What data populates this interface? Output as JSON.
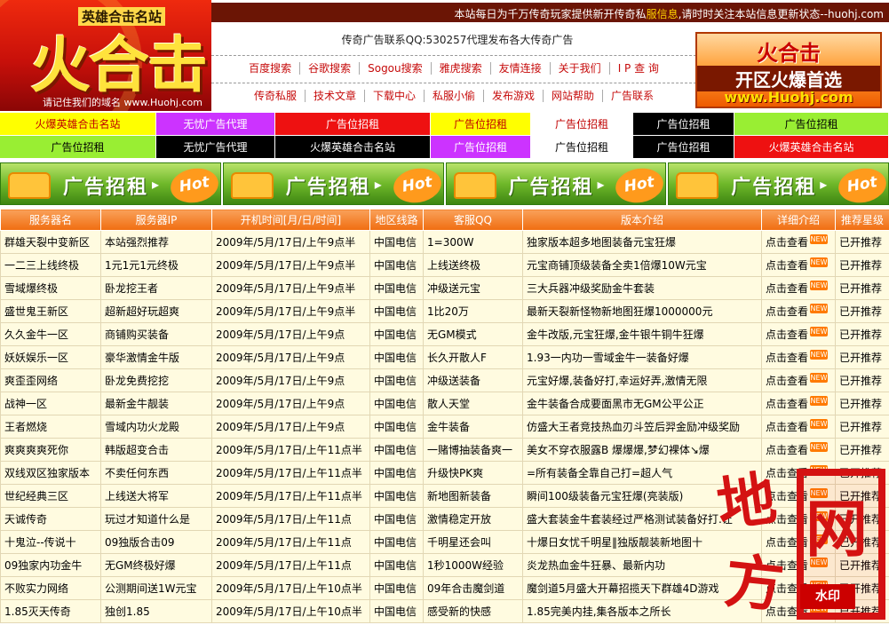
{
  "logo": {
    "top_text": "英雄合击名站",
    "big_text": "火合击",
    "domain_text": "请记住我们的域名 www.Huohj.com"
  },
  "topbar": {
    "text_a": "本站每日为千万传奇玩家提供新开传奇私",
    "text_b": "服信息",
    "text_c": ",请时时关注本站信息更新状态--huohj.com"
  },
  "contact": "传奇广告联系QQ:530257代理发布各大传奇广告",
  "nav_row1": [
    "百度搜索",
    "谷歌搜索",
    "Sogou搜索",
    "雅虎搜索",
    "友情连接",
    "关于我们",
    "I P 查 询"
  ],
  "nav_row2": [
    "传奇私服",
    "技术文章",
    "下载中心",
    "私服小偷",
    "发布游戏",
    "网站帮助",
    "广告联系"
  ],
  "banner_right": {
    "line1": "火合击",
    "line2": "开区火爆首选",
    "line3": "www.Huohj.com"
  },
  "ad_rows": [
    [
      {
        "label": "火爆英雄合击名站",
        "bg": "#ffff00",
        "fg": "#c00000"
      },
      {
        "label": "无忧广告代理",
        "bg": "#cc33ff",
        "fg": "#ffffff"
      },
      {
        "label": "广告位招租",
        "bg": "#ee1111",
        "fg": "#ffffff"
      },
      {
        "label": "广告位招租",
        "bg": "#ffff00",
        "fg": "#c00000"
      },
      {
        "label": "广告位招租",
        "bg": "#ffffff",
        "fg": "#c00000"
      },
      {
        "label": "广告位招租",
        "bg": "#000000",
        "fg": "#ffffff"
      },
      {
        "label": "广告位招租",
        "bg": "#99ee33",
        "fg": "#000000"
      }
    ],
    [
      {
        "label": "广告位招租",
        "bg": "#99ee33",
        "fg": "#000000"
      },
      {
        "label": "无忧广告代理",
        "bg": "#000000",
        "fg": "#ffffff"
      },
      {
        "label": "火爆英雄合击名站",
        "bg": "#000000",
        "fg": "#ffffff"
      },
      {
        "label": "广告位招租",
        "bg": "#cc33ff",
        "fg": "#ffffff"
      },
      {
        "label": "广告位招租",
        "bg": "#ffffff",
        "fg": "#000000"
      },
      {
        "label": "广告位招租",
        "bg": "#000000",
        "fg": "#ffffff"
      },
      {
        "label": "火爆英雄合击名站",
        "bg": "#ee1111",
        "fg": "#ffffff"
      }
    ]
  ],
  "ad_banner": {
    "text": "广告招租",
    "arrow": "▸",
    "hot": "Hot"
  },
  "table": {
    "headers": [
      "服务器名",
      "服务器IP",
      "开机时间[月/日/时间]",
      "地区线路",
      "客服QQ",
      "版本介绍",
      "详细介绍",
      "推荐星级"
    ],
    "detail_text": "点击查看",
    "new_badge": "NEW",
    "rows": [
      [
        "群雄天裂中变新区",
        "本站强烈推荐",
        "2009年/5月/17日/上午9点半",
        "中国电信",
        "1=300W",
        "独家版本超多地图装备元宝狂爆",
        "已开推荐"
      ],
      [
        "一二三上线终极",
        "1元1元1元终极",
        "2009年/5月/17日/上午9点半",
        "中国电信",
        "上线送终极",
        "元宝商铺顶级装备全卖1倍爆10W元宝",
        "已开推荐"
      ],
      [
        "雪域爆终极",
        "卧龙挖王者",
        "2009年/5月/17日/上午9点半",
        "中国电信",
        "冲级送元宝",
        "三大兵器冲级奖励金牛套装",
        "已开推荐"
      ],
      [
        "盛世鬼王新区",
        "超新超好玩超爽",
        "2009年/5月/17日/上午9点半",
        "中国电信",
        "1比20万",
        "最新天裂新怪物新地图狂爆1000000元",
        "已开推荐"
      ],
      [
        "久久金牛一区",
        "商铺购买装备",
        "2009年/5月/17日/上午9点",
        "中国电信",
        "无GM模式",
        "金牛改版,元宝狂爆,金牛银牛铜牛狂爆",
        "已开推荐"
      ],
      [
        "妖妖娱乐一区",
        "豪华激情金牛版",
        "2009年/5月/17日/上午9点",
        "中国电信",
        "长久开散人F",
        "1.93一内功一雪域金牛一装备好爆",
        "已开推荐"
      ],
      [
        "爽歪歪网络",
        "卧龙免费挖挖",
        "2009年/5月/17日/上午9点",
        "中国电信",
        "冲级送装备",
        "元宝好爆,装备好打,幸运好弄,激情无限",
        "已开推荐"
      ],
      [
        "战神一区",
        "最新金牛靓装",
        "2009年/5月/17日/上午9点",
        "中国电信",
        "散人天堂",
        "金牛装备合成要面黑市无GM公平公正",
        "已开推荐"
      ],
      [
        "王者燃烧",
        "雪域内功火龙殿",
        "2009年/5月/17日/上午9点",
        "中国电信",
        "金牛装备",
        "仿盛大王者竞技热血刃斗笠后羿金励冲级奖励",
        "已开推荐"
      ],
      [
        "爽爽爽爽死你",
        "韩版超变合击",
        "2009年/5月/17日/上午11点半",
        "中国电信",
        "一赌博抽装备爽一",
        "美女不穿衣服露B 爆爆爆,梦幻裸体↘爆",
        "已开推荐"
      ],
      [
        "双线双区独家版本",
        "不卖任何东西",
        "2009年/5月/17日/上午11点半",
        "中国电信",
        "升级快PK爽",
        "=所有装备全靠自己打=超人气",
        "已开推荐"
      ],
      [
        "世纪经典三区",
        "上线送大将军",
        "2009年/5月/17日/上午11点半",
        "中国电信",
        "新地图新装备",
        "瞬间100级装备元宝狂爆(亮装版)",
        "已开推荐"
      ],
      [
        "天诚传奇",
        "玩过才知道什么是",
        "2009年/5月/17日/上午11点",
        "中国电信",
        "激情稳定开放",
        "盛大套装金牛套装经过严格测试装备好打.让",
        "已开推荐"
      ],
      [
        "十鬼泣--传说十",
        "09独版合击09",
        "2009年/5月/17日/上午11点",
        "中国电信",
        "千明星还会叫",
        "十爆日女忧千明星‖独版靓装新地图十",
        "已开推荐"
      ],
      [
        "09独家内功金牛",
        "无GM终极好爆",
        "2009年/5月/17日/上午11点",
        "中国电信",
        "1秒1000W经验",
        "炎龙热血金牛狂暴、最新内功",
        "已开推荐"
      ],
      [
        "不败实力网络",
        "公测期间送1W元宝",
        "2009年/5月/17日/上午10点半",
        "中国电信",
        "09年合击魔剑道",
        "魔剑道5月盛大开幕招揽天下群雄4D游戏",
        "已开推荐"
      ],
      [
        "1.85灭天传奇",
        "独创1.85",
        "2009年/5月/17日/上午10点半",
        "中国电信",
        "感受新的快感",
        "1.85完美内挂,集各版本之所长",
        "已开推荐"
      ]
    ]
  },
  "watermark": {
    "char1": "地",
    "char2": "方",
    "char3": "网",
    "stamp": "水印"
  }
}
